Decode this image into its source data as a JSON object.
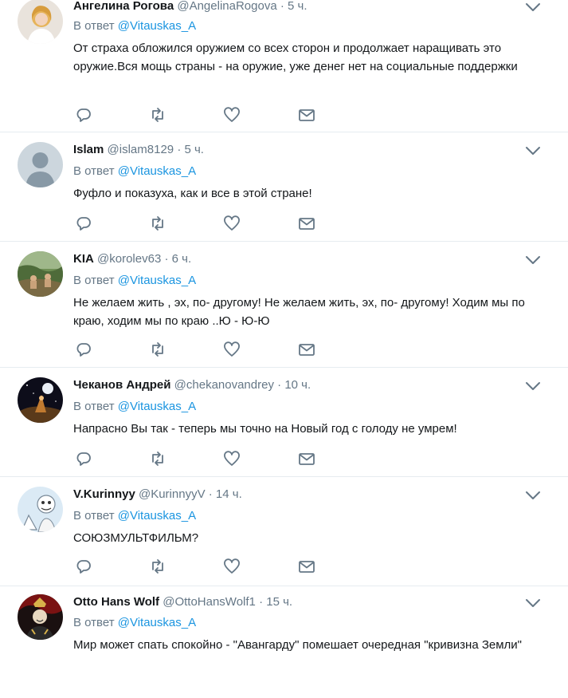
{
  "colors": {
    "text": "#14171a",
    "secondary": "#657786",
    "link": "#1b95e0",
    "divider": "#e6ecf0",
    "icon": "#657786"
  },
  "tweets": [
    {
      "name": "Ангелина Рогова",
      "handle": "@AngelinaRogova",
      "dot": "·",
      "time": "5 ч.",
      "reply_prefix": "В ответ",
      "reply_to": "@Vitauskas_A",
      "text": "От страха обложился оружием со всех сторон и продолжает наращивать это оружие.Вся мощь страны - на оружие, уже денег нет на социальные поддержки",
      "avatar_icon": "user-photo"
    },
    {
      "name": "Islam",
      "handle": "@islam8129",
      "dot": "·",
      "time": "5 ч.",
      "reply_prefix": "В ответ",
      "reply_to": "@Vitauskas_A",
      "text": "Фуфло и показуха, как и все в этой стране!",
      "avatar_icon": "default-avatar"
    },
    {
      "name": "KIA",
      "handle": "@korolev63",
      "dot": "·",
      "time": "6 ч.",
      "reply_prefix": "В ответ",
      "reply_to": "@Vitauskas_A",
      "text": "Не желаем жить , эх, по- другому! Не желаем жить, эх, по- другому! Ходим мы по краю, ходим мы по краю ..Ю - Ю-Ю",
      "avatar_icon": "landscape-photo"
    },
    {
      "name": "Чеканов Андрей",
      "handle": "@chekanovandrey",
      "dot": "·",
      "time": "10 ч.",
      "reply_prefix": "В ответ",
      "reply_to": "@Vitauskas_A",
      "text": "Напрасно Вы так - теперь мы точно на Новый год с голоду не умрем!",
      "avatar_icon": "space-photo"
    },
    {
      "name": "V.Kurinnyy",
      "handle": "@KurinnyyV",
      "dot": "·",
      "time": "14 ч.",
      "reply_prefix": "В ответ",
      "reply_to": "@Vitauskas_A",
      "text": "СОЮЗМУЛЬТФИЛЬМ?",
      "avatar_icon": "cartoon-avatar"
    },
    {
      "name": "Otto Hans Wolf",
      "handle": "@OttoHansWolf1",
      "dot": "·",
      "time": "15 ч.",
      "reply_prefix": "В ответ",
      "reply_to": "@Vitauskas_A",
      "text": "Мир может спать спокойно - \"Авангарду\" помешает очередная \"кривизна Земли\"",
      "avatar_icon": "portrait-avatar"
    }
  ],
  "action_icons": [
    "reply-icon",
    "retweet-icon",
    "like-icon",
    "direct-message-icon"
  ]
}
